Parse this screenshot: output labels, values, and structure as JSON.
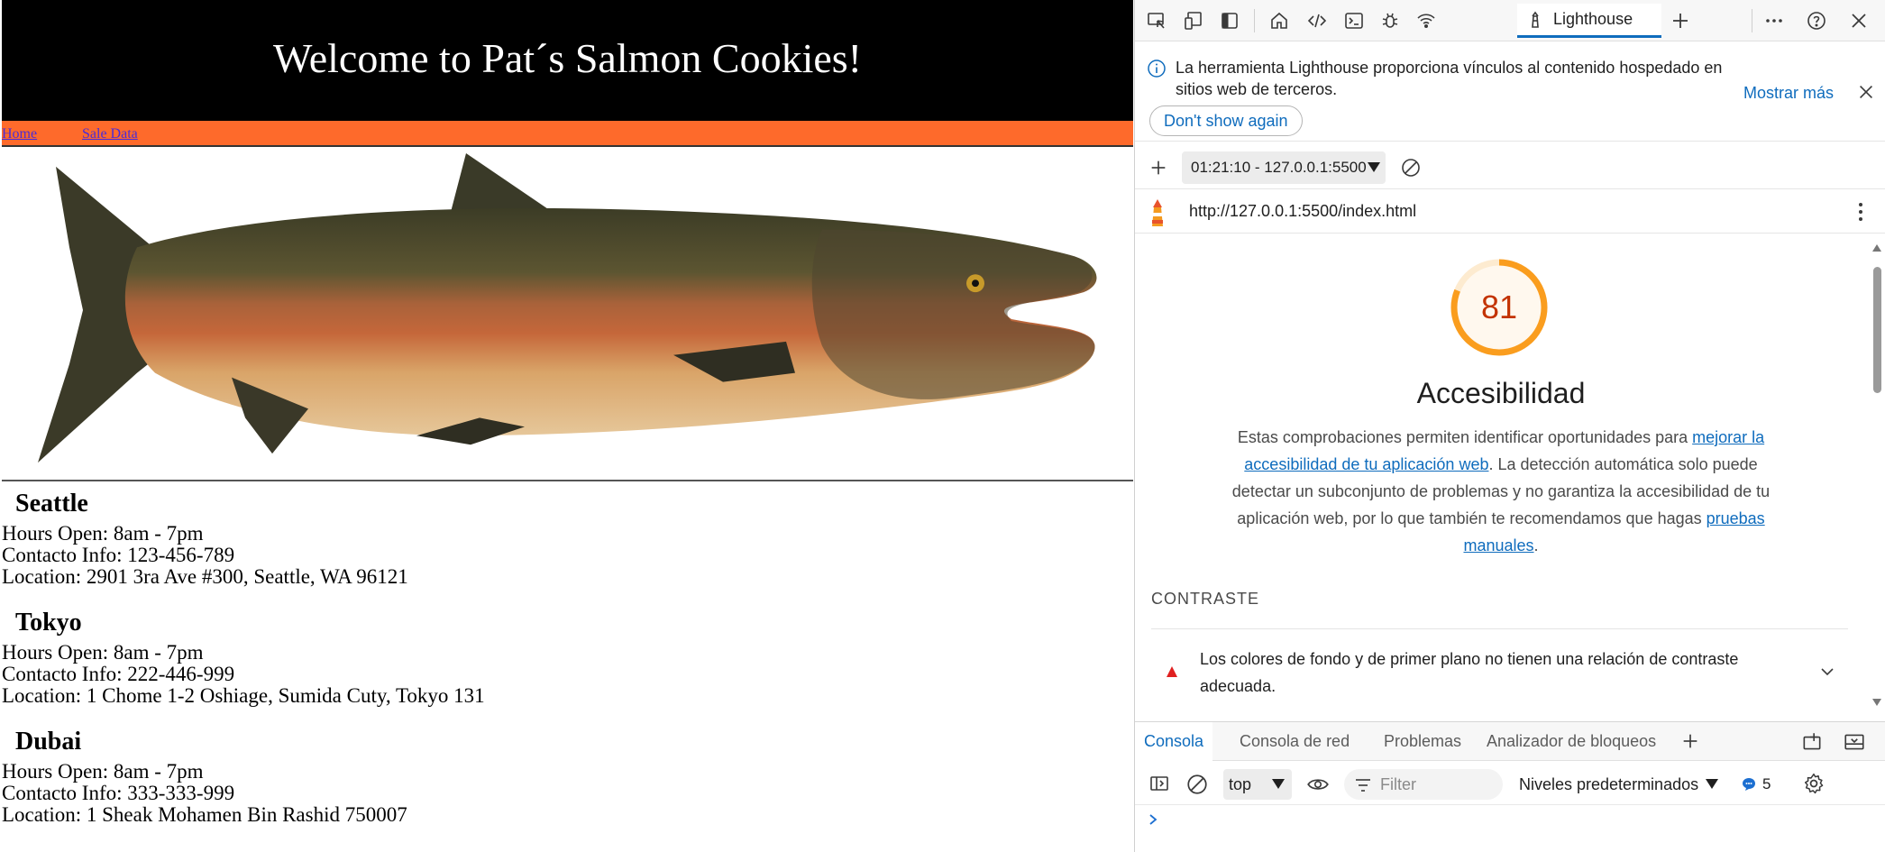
{
  "site": {
    "title": "Welcome to Pat´s Salmon Cookies!",
    "nav": [
      {
        "label": "Home"
      },
      {
        "label": "Sale Data"
      }
    ],
    "stores": [
      {
        "name": "Seattle",
        "hours": "Hours Open: 8am - 7pm",
        "contact": "Contacto Info: 123-456-789",
        "location": "Location: 2901 3ra Ave #300, Seattle, WA 96121"
      },
      {
        "name": "Tokyo",
        "hours": "Hours Open: 8am - 7pm",
        "contact": "Contacto Info: 222-446-999",
        "location": "Location: 1 Chome 1-2 Oshiage, Sumida Cuty, Tokyo 131"
      },
      {
        "name": "Dubai",
        "hours": "Hours Open: 8am - 7pm",
        "contact": "Contacto Info: 333-333-999",
        "location": "Location: 1 Sheak Mohamen Bin Rashid 750007"
      }
    ]
  },
  "devtools": {
    "active_tab": "Lighthouse",
    "toolbar_icons": [
      "inspect-icon",
      "device-emulation-icon",
      "dock-icon",
      "welcome-home-icon",
      "elements-code-icon",
      "console-icon",
      "sources-bug-icon",
      "network-wifi-icon",
      "add-tab-icon",
      "more-icon",
      "help-icon",
      "close-icon"
    ],
    "info": {
      "text": "La herramienta Lighthouse proporciona vínculos al contenido hospedado en sitios web de terceros.",
      "more": "Mostrar más",
      "dismiss": "Don't show again"
    },
    "report_select": "01:21:10 - 127.0.0.1:5500",
    "url": "http://127.0.0.1:5500/index.html",
    "score": "81",
    "score_fraction": 0.81,
    "score_color": "#fa9d1e",
    "score_text_color": "#c33300",
    "category": "Accesibilidad",
    "description": {
      "part1": "Estas comprobaciones permiten identificar oportunidades para ",
      "link1": "mejorar la accesibilidad de tu aplicación web",
      "part2": ". La detección automática solo puede detectar un subconjunto de problemas y no garantiza la accesibilidad de tu aplicación web, por lo que también te recomendamos que hagas ",
      "link2": "pruebas manuales",
      "part3": "."
    },
    "section": "CONTRASTE",
    "audit": "Los colores de fondo y de primer plano no tienen una relación de contraste adecuada.",
    "audit_status_color": "#e02020",
    "drawer_tabs": [
      "Consola",
      "Consola de red",
      "Problemas",
      "Analizador de bloqueos"
    ],
    "console": {
      "context": "top",
      "filter_placeholder": "Filter",
      "levels": "Niveles predeterminados",
      "message_count": "5"
    },
    "accent": "#0f6cbd"
  }
}
